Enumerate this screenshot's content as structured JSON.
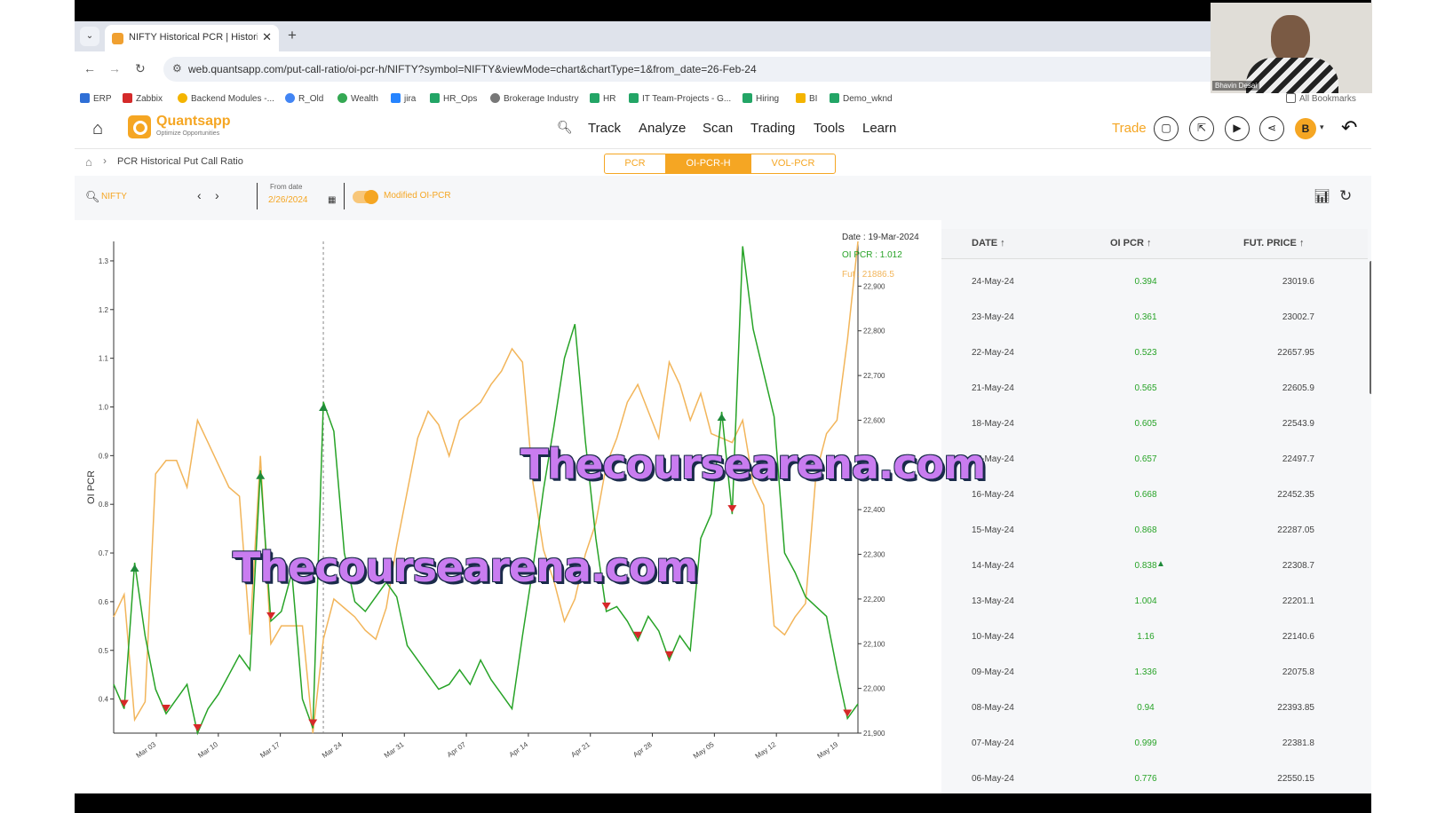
{
  "browser": {
    "tab_title": "NIFTY Historical PCR | Historica",
    "tab_close": "✕",
    "new_tab": "+",
    "url": "web.quantsapp.com/put-call-ratio/oi-pcr-h/NIFTY?symbol=NIFTY&viewMode=chart&chartType=1&from_date=26-Feb-24",
    "bookmarks": [
      "ERP",
      "Zabbix",
      "Backend Modules -...",
      "R_Old",
      "Wealth",
      "jira",
      "HR_Ops",
      "Brokerage Industry",
      "HR",
      "IT Team-Projects - G...",
      "Hiring",
      "BI",
      "Demo_wknd"
    ],
    "all_bookmarks": "All Bookmarks"
  },
  "app": {
    "brand": "Quantsapp",
    "tagline": "Optimize Opportunities",
    "menu": [
      "Track",
      "Analyze",
      "Scan",
      "Trading",
      "Tools",
      "Learn"
    ],
    "trade": "Trade",
    "avatar_initial": "B"
  },
  "breadcrumb": {
    "current": "PCR Historical Put Call Ratio"
  },
  "view_tabs": [
    {
      "label": "PCR",
      "active": false
    },
    {
      "label": "OI-PCR-H",
      "active": true
    },
    {
      "label": "VOL-PCR",
      "active": false
    }
  ],
  "toolbar": {
    "symbol": "NIFTY",
    "from_date_label": "From date",
    "from_date_value": "2/26/2024",
    "toggle_label": "Modified OI-PCR",
    "toggle_on": true
  },
  "colors": {
    "accent": "#f5a623",
    "pcr_green": "#27a327",
    "fut_orange": "#f2b55a",
    "down_marker": "#d62828",
    "up_marker": "#1f8a3a"
  },
  "chart_data": {
    "type": "line",
    "ylabel": "OI PCR",
    "x_tick_labels": [
      "Mar 03",
      "Mar 10",
      "Mar 17",
      "Mar 24",
      "Mar 31",
      "Apr 07",
      "Apr 14",
      "Apr 21",
      "Apr 28",
      "May 05",
      "May 12",
      "May 19"
    ],
    "y_left_ticks": [
      "1.3",
      "1.2",
      "1.1",
      "1.0",
      "0.9",
      "0.8",
      "0.7",
      "0.6",
      "0.5",
      "0.4"
    ],
    "y_right_ticks": [
      "22,900",
      "22,800",
      "22,700",
      "22,600",
      "22,400",
      "22,300",
      "22,200",
      "22,100",
      "22,000",
      "21,900"
    ],
    "ylim_left": [
      0.33,
      1.34
    ],
    "ylim_right": [
      21900,
      23000
    ],
    "series": [
      {
        "axis": "left",
        "values": [
          0.43,
          0.38,
          0.68,
          0.53,
          0.42,
          0.37,
          0.4,
          0.43,
          0.33,
          0.38,
          0.41,
          0.45,
          0.49,
          0.46,
          0.87,
          0.56,
          0.58,
          0.66,
          0.4,
          0.34,
          1.01,
          0.95,
          0.7,
          0.6,
          0.58,
          0.61,
          0.64,
          0.61,
          0.51,
          0.48,
          0.45,
          0.42,
          0.43,
          0.46,
          0.43,
          0.48,
          0.44,
          0.41,
          0.38,
          0.53,
          0.67,
          0.83,
          0.96,
          1.1,
          1.17,
          0.93,
          0.73,
          0.58,
          0.59,
          0.56,
          0.52,
          0.57,
          0.54,
          0.48,
          0.53,
          0.5,
          0.73,
          0.78,
          0.99,
          0.78,
          1.33,
          1.16,
          1.07,
          0.98,
          0.7,
          0.66,
          0.61,
          0.59,
          0.57,
          0.46,
          0.36,
          0.39
        ]
      },
      {
        "axis": "right",
        "values": [
          22160,
          22210,
          21930,
          21970,
          22480,
          22510,
          22510,
          22450,
          22600,
          22550,
          22500,
          22450,
          22430,
          22120,
          22520,
          22100,
          22140,
          22140,
          22140,
          21900,
          22110,
          22200,
          22180,
          22160,
          22130,
          22110,
          22180,
          22320,
          22440,
          22560,
          22620,
          22590,
          22520,
          22600,
          22620,
          22640,
          22680,
          22710,
          22760,
          22730,
          22460,
          22310,
          22240,
          22150,
          22200,
          22300,
          22370,
          22500,
          22560,
          22640,
          22680,
          22620,
          22560,
          22730,
          22680,
          22600,
          22660,
          22570,
          22560,
          22550,
          22600,
          22460,
          22410,
          22140,
          22120,
          22160,
          22190,
          22480,
          22570,
          22600,
          22780,
          23000
        ]
      }
    ],
    "tooltip": {
      "date": "Date : 19-Mar-2024",
      "oi_pcr": "OI PCR : 1.012",
      "fut": "Fut : 21886.5"
    }
  },
  "table": {
    "headers": [
      "DATE ↑",
      "OI PCR ↑",
      "FUT. PRICE ↑"
    ],
    "rows": [
      {
        "date": "24-May-24",
        "pcr": "0.394",
        "fut": "23019.6",
        "up": false
      },
      {
        "date": "23-May-24",
        "pcr": "0.361",
        "fut": "23002.7",
        "up": false
      },
      {
        "date": "22-May-24",
        "pcr": "0.523",
        "fut": "22657.95",
        "up": false
      },
      {
        "date": "21-May-24",
        "pcr": "0.565",
        "fut": "22605.9",
        "up": false
      },
      {
        "date": "18-May-24",
        "pcr": "0.605",
        "fut": "22543.9",
        "up": false
      },
      {
        "date": "17-May-24",
        "pcr": "0.657",
        "fut": "22497.7",
        "up": false
      },
      {
        "date": "16-May-24",
        "pcr": "0.668",
        "fut": "22452.35",
        "up": false
      },
      {
        "date": "15-May-24",
        "pcr": "0.868",
        "fut": "22287.05",
        "up": false
      },
      {
        "date": "14-May-24",
        "pcr": "0.838",
        "fut": "22308.7",
        "up": true
      },
      {
        "date": "13-May-24",
        "pcr": "1.004",
        "fut": "22201.1",
        "up": false
      },
      {
        "date": "10-May-24",
        "pcr": "1.16",
        "fut": "22140.6",
        "up": false
      },
      {
        "date": "09-May-24",
        "pcr": "1.336",
        "fut": "22075.8",
        "up": false
      },
      {
        "date": "08-May-24",
        "pcr": "0.94",
        "fut": "22393.85",
        "up": false
      },
      {
        "date": "07-May-24",
        "pcr": "0.999",
        "fut": "22381.8",
        "up": false
      },
      {
        "date": "06-May-24",
        "pcr": "0.776",
        "fut": "22550.15",
        "up": false
      }
    ]
  },
  "webcam": {
    "name": "Bhavin Desai"
  },
  "watermark": "Thecoursearena.com"
}
